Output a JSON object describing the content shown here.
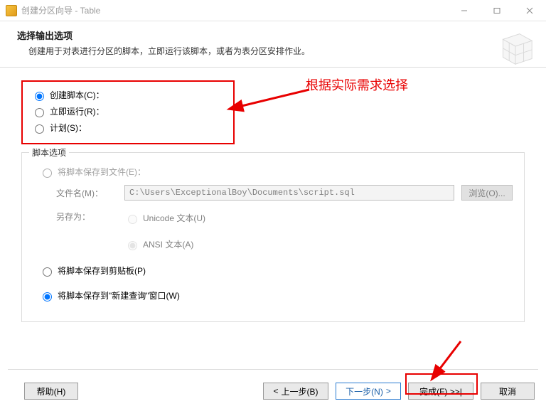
{
  "window": {
    "title": "创建分区向导 - Table"
  },
  "header": {
    "title": "选择输出选项",
    "subtitle": "创建用于对表进行分区的脚本，立即运行该脚本，或者为表分区安排作业。"
  },
  "annotation": {
    "hint": "根据实际需求选择"
  },
  "options": {
    "create_script": "创建脚本(C)：",
    "run_now": "立即运行(R)：",
    "schedule": "计划(S)："
  },
  "script_options": {
    "legend": "脚本选项",
    "save_to_file": "将脚本保存到文件(E)：",
    "filename_label": "文件名(M)：",
    "filename_value": "C:\\Users\\ExceptionalBoy\\Documents\\script.sql",
    "browse": "浏览(O)...",
    "save_as_label": "另存为：",
    "unicode": "Unicode 文本(U)",
    "ansi": "ANSI 文本(A)",
    "save_to_clipboard": "将脚本保存到剪贴板(P)",
    "save_to_new_query": "将脚本保存到\"新建查询\"窗口(W)"
  },
  "buttons": {
    "help": "帮助(H)",
    "back": "上一步(B)",
    "next": "下一步(N)",
    "finish": "完成(F) >>|",
    "cancel": "取消"
  }
}
